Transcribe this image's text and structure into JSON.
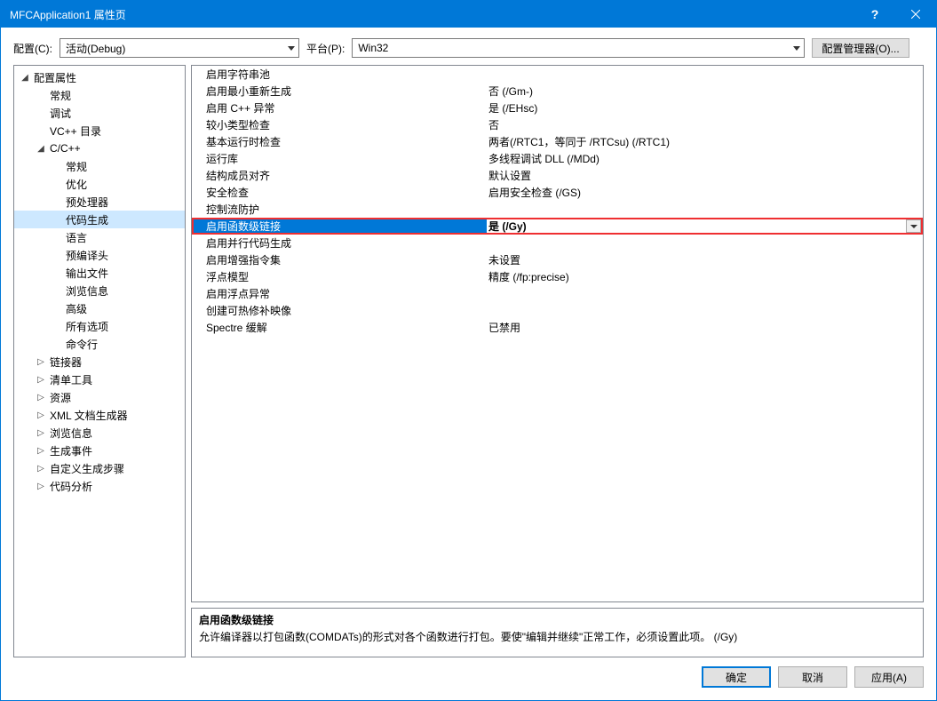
{
  "title": "MFCApplication1 属性页",
  "toolbar": {
    "config_label": "配置(C):",
    "config_value": "活动(Debug)",
    "platform_label": "平台(P):",
    "platform_value": "Win32",
    "cfgmgr_label": "配置管理器(O)..."
  },
  "tree": [
    {
      "label": "配置属性",
      "depth": 0,
      "expander": "open"
    },
    {
      "label": "常规",
      "depth": 1,
      "expander": "none"
    },
    {
      "label": "调试",
      "depth": 1,
      "expander": "none"
    },
    {
      "label": "VC++ 目录",
      "depth": 1,
      "expander": "none"
    },
    {
      "label": "C/C++",
      "depth": 1,
      "expander": "open"
    },
    {
      "label": "常规",
      "depth": 2,
      "expander": "none"
    },
    {
      "label": "优化",
      "depth": 2,
      "expander": "none"
    },
    {
      "label": "预处理器",
      "depth": 2,
      "expander": "none"
    },
    {
      "label": "代码生成",
      "depth": 2,
      "expander": "none",
      "selected": true
    },
    {
      "label": "语言",
      "depth": 2,
      "expander": "none"
    },
    {
      "label": "预编译头",
      "depth": 2,
      "expander": "none"
    },
    {
      "label": "输出文件",
      "depth": 2,
      "expander": "none"
    },
    {
      "label": "浏览信息",
      "depth": 2,
      "expander": "none"
    },
    {
      "label": "高级",
      "depth": 2,
      "expander": "none"
    },
    {
      "label": "所有选项",
      "depth": 2,
      "expander": "none"
    },
    {
      "label": "命令行",
      "depth": 2,
      "expander": "none"
    },
    {
      "label": "链接器",
      "depth": 1,
      "expander": "closed"
    },
    {
      "label": "清单工具",
      "depth": 1,
      "expander": "closed"
    },
    {
      "label": "资源",
      "depth": 1,
      "expander": "closed"
    },
    {
      "label": "XML 文档生成器",
      "depth": 1,
      "expander": "closed"
    },
    {
      "label": "浏览信息",
      "depth": 1,
      "expander": "closed"
    },
    {
      "label": "生成事件",
      "depth": 1,
      "expander": "closed"
    },
    {
      "label": "自定义生成步骤",
      "depth": 1,
      "expander": "closed"
    },
    {
      "label": "代码分析",
      "depth": 1,
      "expander": "closed"
    }
  ],
  "props": [
    {
      "name": "启用字符串池",
      "value": ""
    },
    {
      "name": "启用最小重新生成",
      "value": "否 (/Gm-)"
    },
    {
      "name": "启用 C++ 异常",
      "value": "是 (/EHsc)"
    },
    {
      "name": "较小类型检查",
      "value": "否"
    },
    {
      "name": "基本运行时检查",
      "value": "两者(/RTC1，等同于 /RTCsu) (/RTC1)"
    },
    {
      "name": "运行库",
      "value": "多线程调试 DLL (/MDd)"
    },
    {
      "name": "结构成员对齐",
      "value": "默认设置"
    },
    {
      "name": "安全检查",
      "value": "启用安全检查 (/GS)"
    },
    {
      "name": "控制流防护",
      "value": ""
    },
    {
      "name": "启用函数级链接",
      "value": "是 (/Gy)",
      "selected": true
    },
    {
      "name": "启用并行代码生成",
      "value": ""
    },
    {
      "name": "启用增强指令集",
      "value": "未设置"
    },
    {
      "name": "浮点模型",
      "value": "精度 (/fp:precise)"
    },
    {
      "name": "启用浮点异常",
      "value": ""
    },
    {
      "name": "创建可热修补映像",
      "value": ""
    },
    {
      "name": "Spectre 缓解",
      "value": "已禁用"
    }
  ],
  "desc": {
    "title": "启用函数级链接",
    "body": "允许编译器以打包函数(COMDATs)的形式对各个函数进行打包。要使\"编辑并继续\"正常工作，必须设置此项。     (/Gy)"
  },
  "footer": {
    "ok": "确定",
    "cancel": "取消",
    "apply": "应用(A)"
  }
}
